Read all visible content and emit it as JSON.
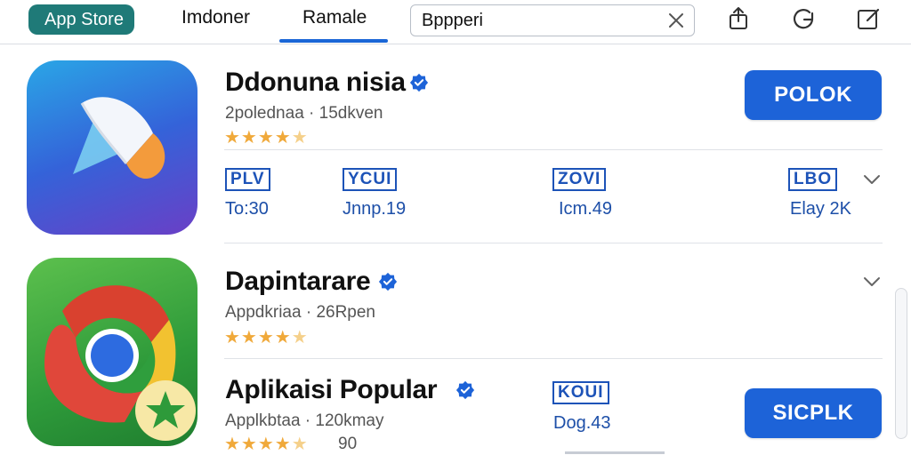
{
  "header": {
    "brand_label": "App Store",
    "tabs": [
      {
        "label": "Imdoner"
      },
      {
        "label": "Ramale",
        "active": true
      }
    ],
    "search": {
      "value": "Bppperi"
    },
    "icons": [
      "share-icon",
      "refresh-icon",
      "edit-icon"
    ]
  },
  "apps": [
    {
      "name": "Ddonuna nisia",
      "meta": "2polednaa · 15dkven",
      "rating_stars": 4.5,
      "button_label": "POLOK",
      "stats": [
        {
          "label": "PLV",
          "value": "To:30"
        },
        {
          "label": "YCUI",
          "value": "Jnnp.19"
        },
        {
          "label": "ZOVI",
          "value": "Icm.49"
        },
        {
          "label": "LBO",
          "value": "Elay 2K"
        }
      ]
    },
    {
      "name": "Dapintarare",
      "meta": "Appdkriaa · 26Rpen",
      "rating_stars": 4.5
    },
    {
      "name": "Aplikaisi Popular",
      "meta": "Applkbtaa · 120kmay",
      "rating_stars": 4.5,
      "rating_count": "90",
      "button_label": "SICPLK",
      "stats": [
        {
          "label": "KOUI",
          "value": "Dog.43"
        }
      ]
    }
  ],
  "colors": {
    "brand": "#1f7a78",
    "accent": "#1d63d8",
    "stars": "#f0a93a"
  }
}
